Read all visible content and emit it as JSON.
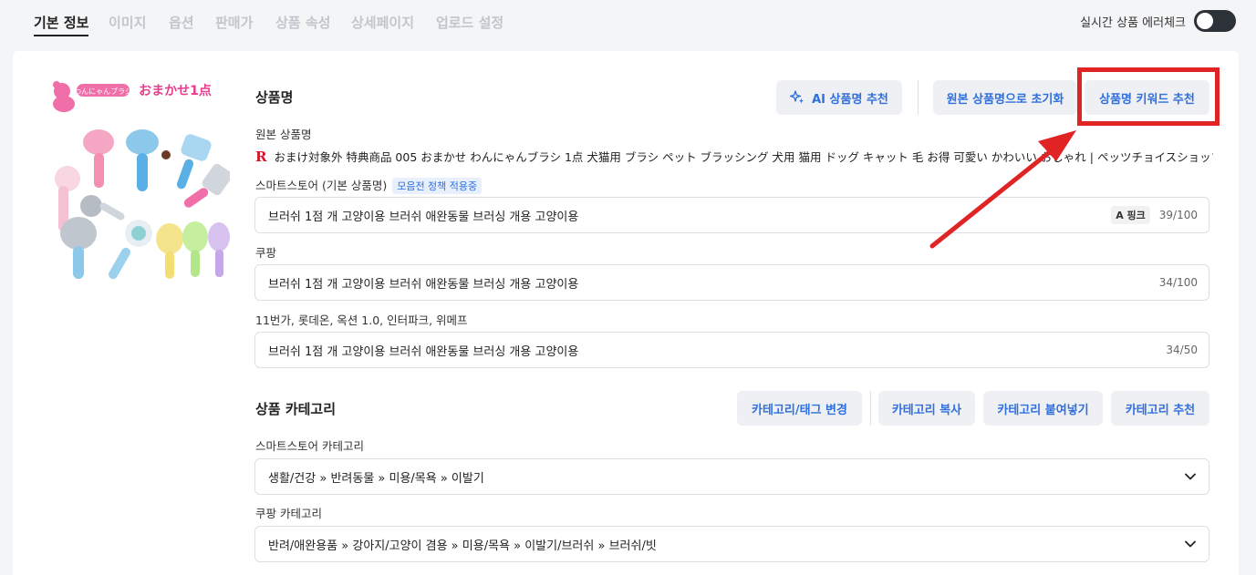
{
  "tabs": [
    {
      "label": "기본 정보",
      "active": true
    },
    {
      "label": "이미지"
    },
    {
      "label": "옵션"
    },
    {
      "label": "판매가"
    },
    {
      "label": "상품 속성"
    },
    {
      "label": "상세페이지"
    },
    {
      "label": "업로드 설정"
    }
  ],
  "realtime_check": {
    "label": "실시간 상품 에러체크",
    "enabled": false
  },
  "product_name": {
    "title": "상품명",
    "buttons": {
      "ai_recommend": "AI 상품명 추천",
      "reset_original": "원본 상품명으로 초기화",
      "keyword_recommend": "상품명 키워드 추천"
    },
    "original_label": "원본 상품명",
    "original_value": "おまけ対象外 特典商品 005 おまかせ わんにゃんブラシ 1点 犬猫用 ブラシ ペット ブラッシング 犬用 猫用 ドッグ キャット 毛 お得 可愛い かわいい おしゃれ | ペッツチョイスショップ",
    "smartstore_label": "스마트스토어 (기본 상품명)",
    "policy_badge": "모음전 정책 적용중",
    "smartstore_value": "브러쉬 1점 개 고양이용 브러쉬 애완동물 브러싱 개용 고양이용",
    "smartstore_chip": "A 핑크",
    "smartstore_count": "39/100",
    "coupang_label": "쿠팡",
    "coupang_value": "브러쉬 1점 개 고양이용 브러쉬 애완동물 브러싱 개용 고양이용",
    "coupang_count": "34/100",
    "others_label": "11번가, 롯데온, 옥션 1.0, 인터파크, 위메프",
    "others_value": "브러쉬 1점 개 고양이용 브러쉬 애완동물 브러싱 개용 고양이용",
    "others_count": "34/50"
  },
  "category": {
    "title": "상품 카테고리",
    "buttons": {
      "change": "카테고리/태그 변경",
      "copy": "카테고리 복사",
      "paste": "카테고리 붙여넣기",
      "recommend": "카테고리 추천"
    },
    "smartstore_label": "스마트스토어 카테고리",
    "smartstore_value": "생활/건강 » 반려동물 » 미용/목욕 » 이발기",
    "coupang_label": "쿠팡 카테고리",
    "coupang_value": "반려/애완용품 » 강아지/고양이 겸용 » 미용/목욕 » 이발기/브러쉬 » 브러쉬/빗"
  },
  "image": {
    "banner_text_left": "わんにゃんブラシ",
    "banner_text_right": "おまかせ1点"
  },
  "colors": {
    "accent": "#2f6fde",
    "highlight": "#e02424",
    "toggle_bg": "#2d3138"
  }
}
